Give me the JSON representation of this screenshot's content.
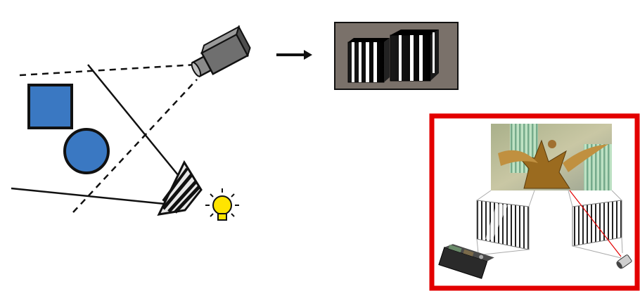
{
  "colors": {
    "background": "#ffffff",
    "shape_fill": "#3a78c2",
    "shape_stroke": "#111111",
    "camera_body": "#6f6f6f",
    "bulb": "#ffe400",
    "highlight_frame": "#e30000",
    "captured_frame_bg": "#7a716a"
  },
  "icons": {
    "camera": "camera-icon",
    "light_bulb": "light-bulb-icon",
    "projector": "projector-icon",
    "arrow": "arrow-right-icon"
  }
}
